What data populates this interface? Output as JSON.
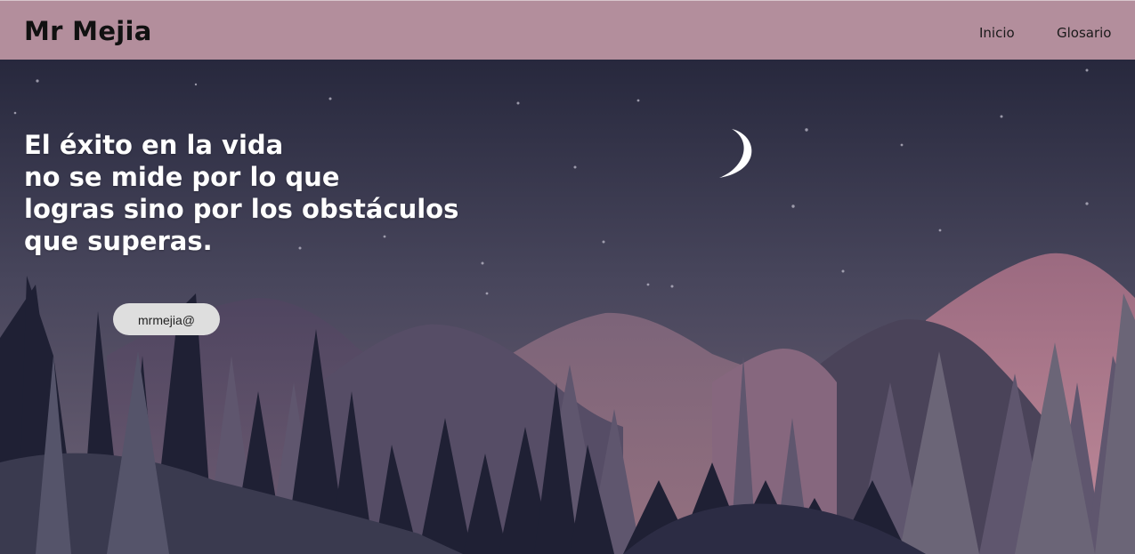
{
  "navbar": {
    "brand": "Mr Mejia",
    "links": [
      {
        "label": "Inicio"
      },
      {
        "label": "Glosario"
      }
    ]
  },
  "hero": {
    "quote_lines": [
      "El éxito en la vida",
      "no se mide por lo que",
      "logras sino por los obstáculos",
      "que superas."
    ],
    "contact_button": "mrmejia@"
  },
  "colors": {
    "navbar_bg": "#b38e9c",
    "sky_top": "#27283d",
    "sky_bottom": "#6b5f72",
    "mountain_pink": "#b27f90",
    "moon": "#ffffff"
  },
  "icons": {
    "moon": "crescent-moon-icon"
  }
}
